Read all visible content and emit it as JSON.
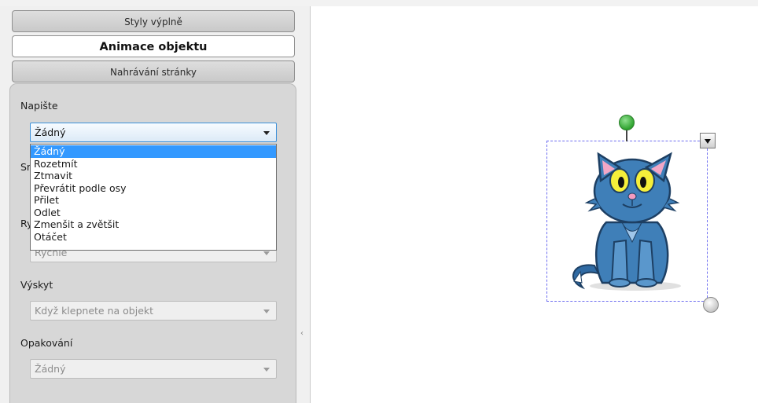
{
  "panel": {
    "tabs": [
      {
        "label": "Styly výplně",
        "active": false
      },
      {
        "label": "Animace objektu",
        "active": true
      },
      {
        "label": "Nahrávání stránky",
        "active": false
      }
    ],
    "type": {
      "label": "Napište",
      "value": "Žádný"
    },
    "direction": {
      "label_partial": "Sm"
    },
    "speed": {
      "label_partial": "Ry",
      "value_partial": "Rychle"
    },
    "occurrence": {
      "label": "Výskyt",
      "value": "Když klepnete na objekt"
    },
    "repeat": {
      "label": "Opakování",
      "value": "Žádný"
    },
    "dropdown_options": [
      {
        "label": "Žádný",
        "selected": true
      },
      {
        "label": "Rozetmít",
        "selected": false
      },
      {
        "label": "Ztmavit",
        "selected": false
      },
      {
        "label": "Převrátit podle osy",
        "selected": false
      },
      {
        "label": "Přilet",
        "selected": false
      },
      {
        "label": "Odlet",
        "selected": false
      },
      {
        "label": "Zmenšit a zvětšit",
        "selected": false
      },
      {
        "label": "Otáčet",
        "selected": false
      }
    ]
  },
  "colors": {
    "selection_border": "#6e6ef0",
    "rotation_handle": "#2fa32f",
    "dropdown_highlight": "#3399ff",
    "cat_body": "#3f7fb8"
  },
  "canvas": {
    "object_icon": "blue-cat-clipart"
  }
}
